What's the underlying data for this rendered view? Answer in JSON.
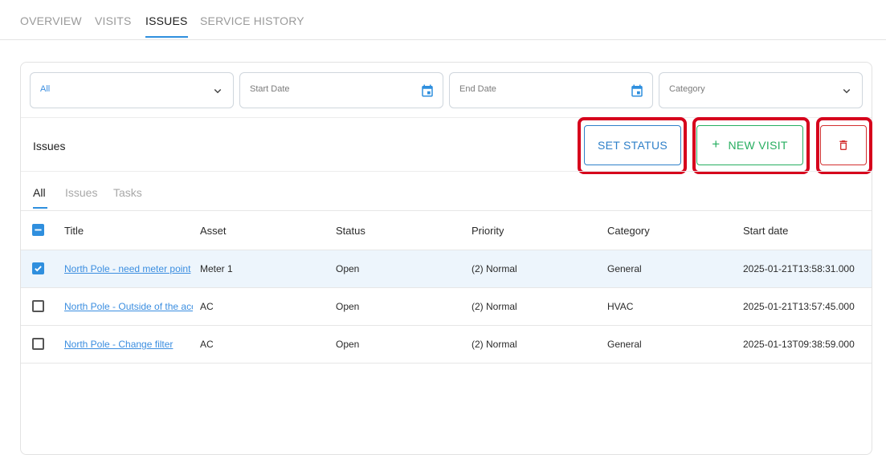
{
  "top_tabs": [
    {
      "label": "OVERVIEW",
      "active": false
    },
    {
      "label": "VISITS",
      "active": false
    },
    {
      "label": "ISSUES",
      "active": true
    },
    {
      "label": "SERVICE HISTORY",
      "active": false
    }
  ],
  "filters": {
    "status": {
      "value": "All"
    },
    "start_date": {
      "placeholder": "Start Date"
    },
    "end_date": {
      "placeholder": "End Date"
    },
    "category": {
      "placeholder": "Category"
    }
  },
  "section_title": "Issues",
  "actions": {
    "set_status": "SET STATUS",
    "new_visit": "NEW VISIT",
    "delete_icon": "trash-icon"
  },
  "sub_tabs": [
    {
      "label": "All",
      "active": true
    },
    {
      "label": "Issues",
      "active": false
    },
    {
      "label": "Tasks",
      "active": false
    }
  ],
  "table": {
    "columns": [
      "Title",
      "Asset",
      "Status",
      "Priority",
      "Category",
      "Start date"
    ],
    "header_checkbox": "indeterminate",
    "rows": [
      {
        "checked": true,
        "title": "North Pole - need meter point",
        "asset": "Meter 1",
        "status": "Open",
        "priority": "(2) Normal",
        "category": "General",
        "start_date": "2025-01-21T13:58:31.000"
      },
      {
        "checked": false,
        "title": "North Pole - Outside of the acc",
        "asset": "AC",
        "status": "Open",
        "priority": "(2) Normal",
        "category": "HVAC",
        "start_date": "2025-01-21T13:57:45.000"
      },
      {
        "checked": false,
        "title": "North Pole - Change filter",
        "asset": "AC",
        "status": "Open",
        "priority": "(2) Normal",
        "category": "General",
        "start_date": "2025-01-13T09:38:59.000"
      }
    ]
  },
  "colors": {
    "accent": "#2f8fde",
    "success": "#27ae60",
    "danger": "#d32f2f",
    "highlight": "#d6001c"
  }
}
